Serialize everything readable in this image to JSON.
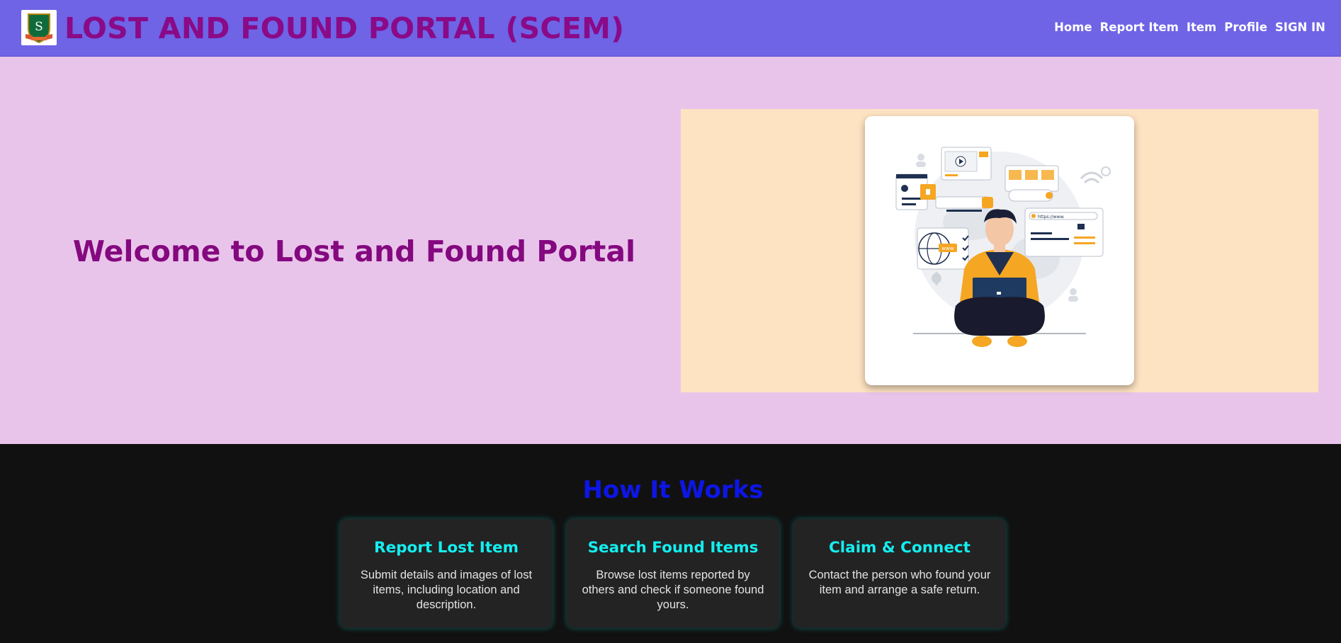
{
  "header": {
    "logo_letter": "S",
    "title": "LOST AND FOUND PORTAL (SCEM)",
    "nav": [
      {
        "label": "Home"
      },
      {
        "label": "Report Item"
      },
      {
        "label": "Item"
      },
      {
        "label": "Profile"
      },
      {
        "label": "SIGN IN"
      }
    ]
  },
  "hero": {
    "welcome": "Welcome to Lost and Found Portal",
    "illustration": {
      "icon": "person-with-laptop-illustration",
      "url_bar_text": "https://www.",
      "www_badge": "www"
    }
  },
  "how_it_works": {
    "title": "How It Works",
    "steps": [
      {
        "title": "Report Lost Item",
        "desc": "Submit details and images of lost items, including location and description."
      },
      {
        "title": "Search Found Items",
        "desc": "Browse lost items reported by others and check if someone found yours."
      },
      {
        "title": "Claim & Connect",
        "desc": "Contact the person who found your item and arrange a safe return."
      }
    ]
  },
  "colors": {
    "header_bg": "#6f63e6",
    "title": "#8a0a87",
    "hero_bg": "#e9c4ea",
    "hero_panel": "#fee3c2",
    "how_title": "#0d16e6",
    "step_title": "#14eef0",
    "footer_bg": "#111111"
  }
}
